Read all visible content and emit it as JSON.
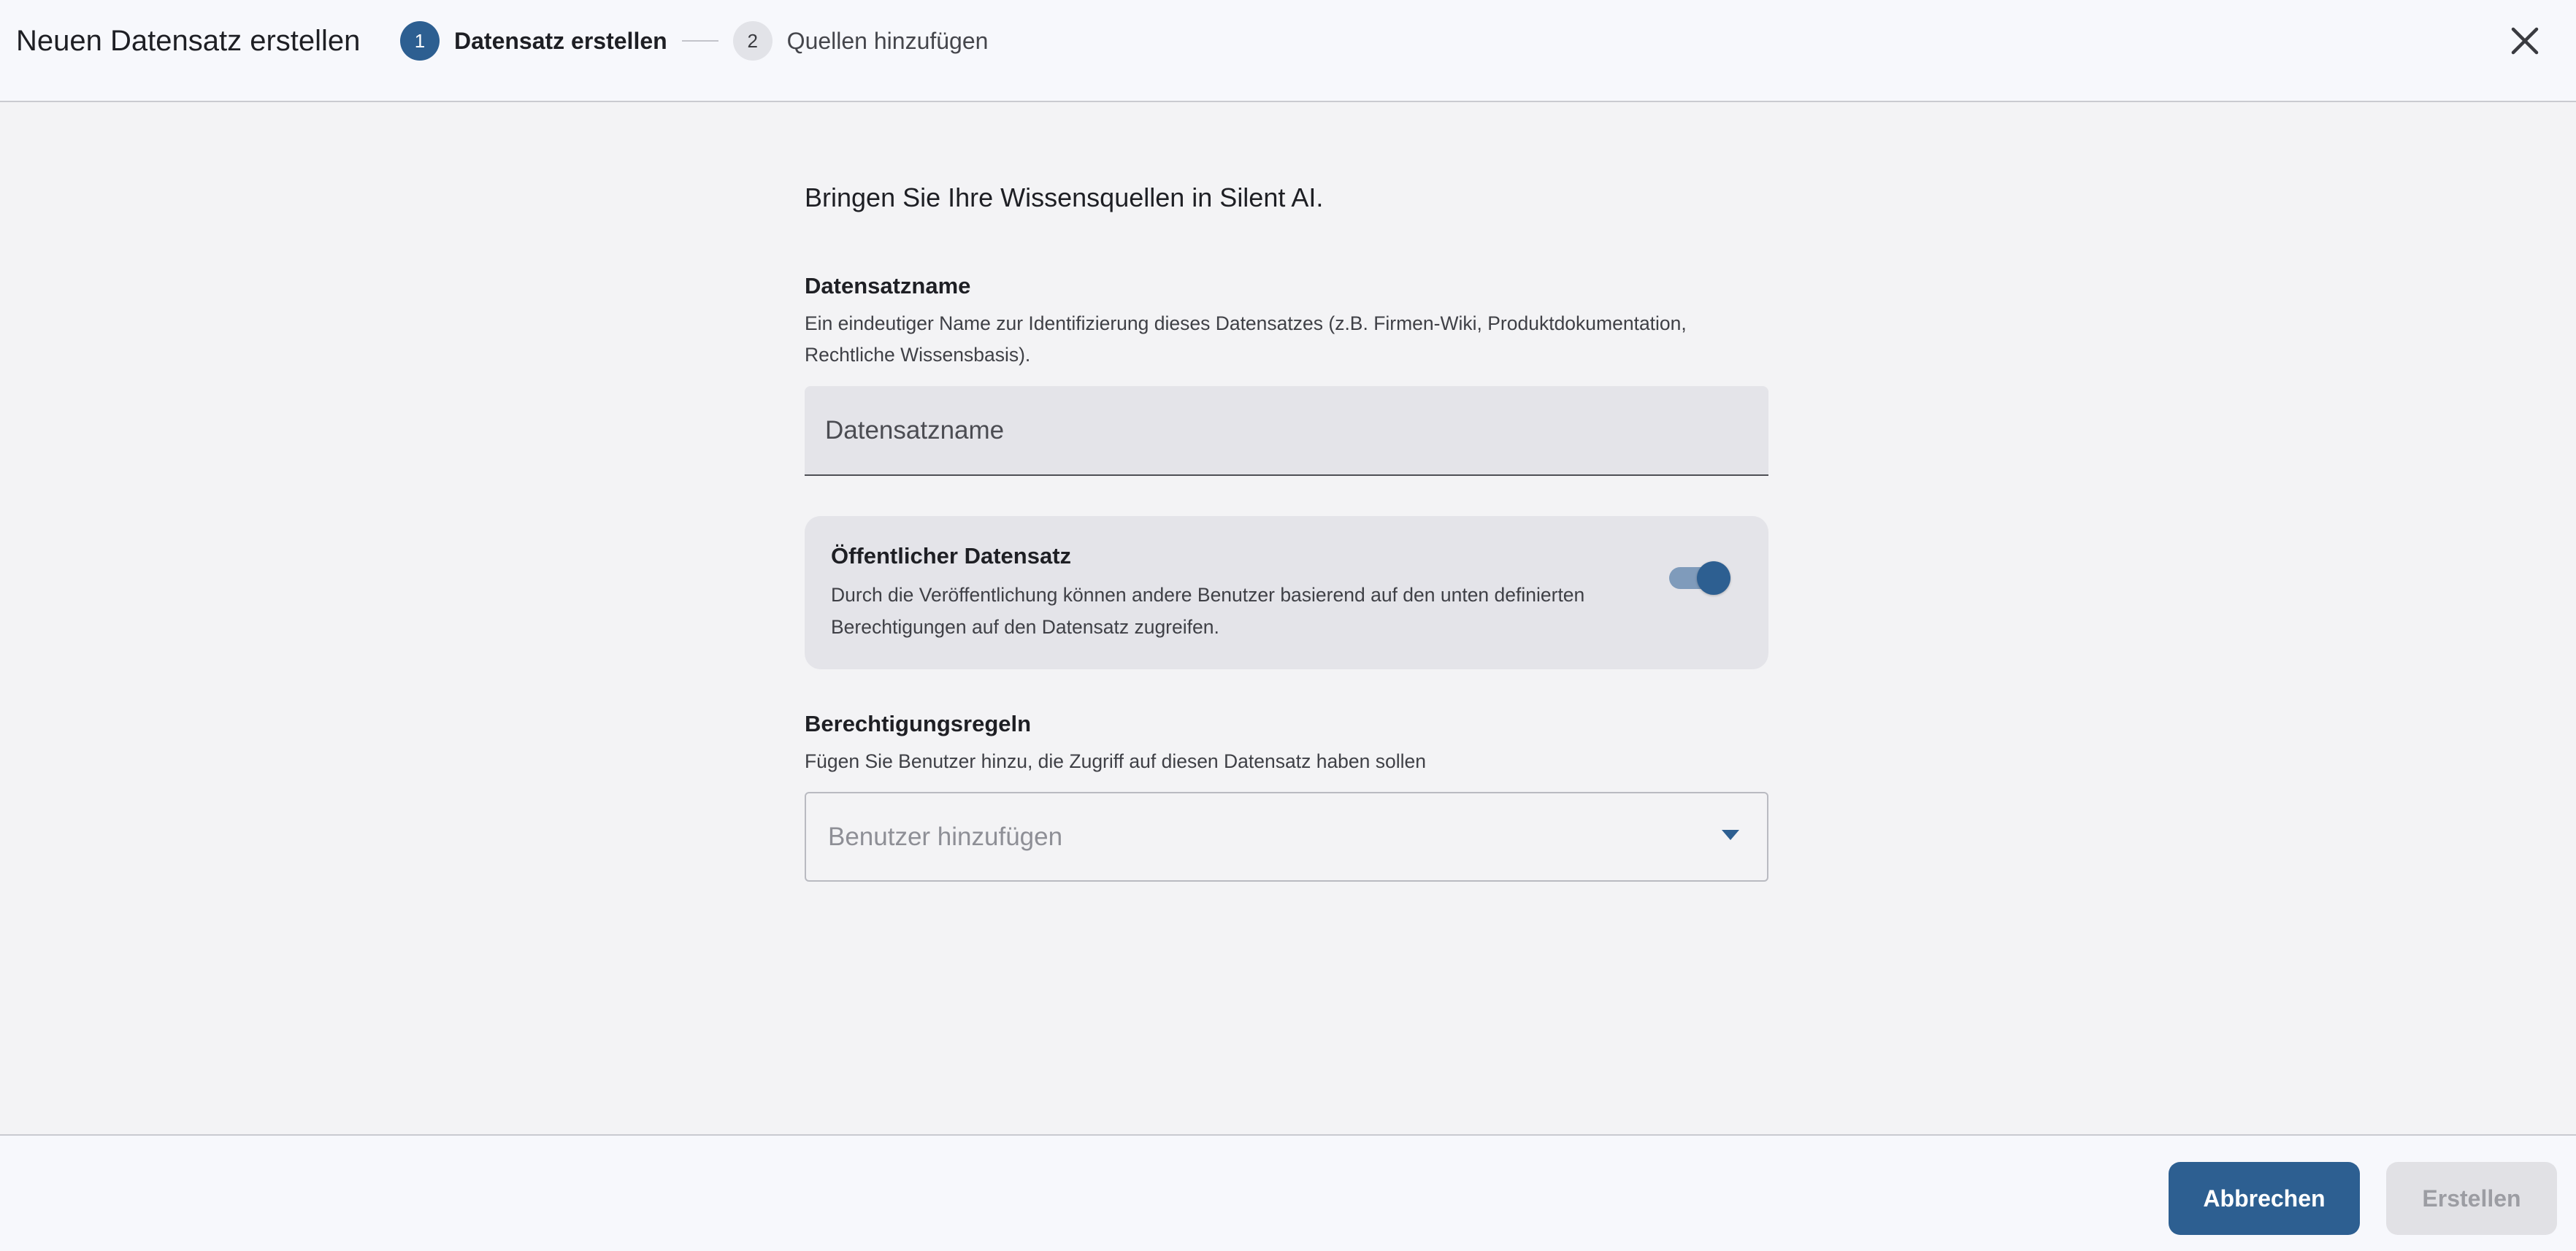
{
  "header": {
    "title": "Neuen Datensatz erstellen",
    "steps": [
      {
        "number": "1",
        "label": "Datensatz erstellen",
        "active": true
      },
      {
        "number": "2",
        "label": "Quellen hinzufügen",
        "active": false
      }
    ],
    "close_icon": "close-icon"
  },
  "form": {
    "intro": "Bringen Sie Ihre Wissensquellen in Silent AI.",
    "name_section": {
      "title": "Datensatzname",
      "description": "Ein eindeutiger Name zur Identifizierung dieses Datensatzes (z.B. Firmen-Wiki, Produktdokumentation, Rechtliche Wissensbasis).",
      "placeholder": "Datensatzname",
      "value": ""
    },
    "public_section": {
      "title": "Öffentlicher Datensatz",
      "description": "Durch die Veröffentlichung können andere Benutzer basierend auf den unten definierten Berechtigungen auf den Datensatz zugreifen.",
      "enabled": true
    },
    "permissions_section": {
      "title": "Berechtigungsregeln",
      "description": "Fügen Sie Benutzer hinzu, die Zugriff auf diesen Datensatz haben sollen",
      "placeholder": "Benutzer hinzufügen",
      "dropdown_icon": "caret-down-icon"
    }
  },
  "footer": {
    "cancel_label": "Abbrechen",
    "create_label": "Erstellen"
  },
  "colors": {
    "primary": "#2d5f91",
    "toggle_track": "#7f9bbb",
    "header_bg": "#f7f8fc",
    "page_bg": "#f3f3f5",
    "field_bg": "#e4e4e9",
    "disabled_bg": "#e1e1e5",
    "disabled_text": "#9c9da3"
  }
}
